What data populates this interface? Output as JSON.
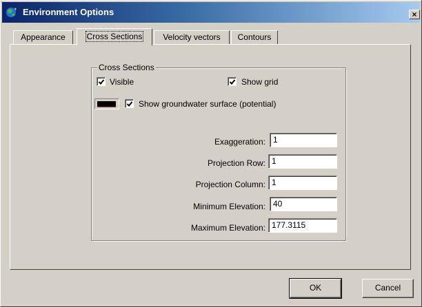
{
  "window": {
    "title": "Environment Options",
    "close_glyph": "×",
    "icon": "globe-icon"
  },
  "tabs": [
    {
      "label": "Appearance",
      "active": false
    },
    {
      "label": "Cross Sections",
      "active": true
    },
    {
      "label": "Velocity vectors",
      "active": false
    },
    {
      "label": "Contours",
      "active": false
    }
  ],
  "cross_sections": {
    "group_label": "Cross Sections",
    "visible": {
      "label": "Visible",
      "checked": true
    },
    "show_grid": {
      "label": "Show grid",
      "checked": true
    },
    "groundwater": {
      "label": "Show groundwater surface (potential)",
      "checked": true,
      "color": "#000000"
    },
    "fields": [
      {
        "label": "Exaggeration:",
        "value": "1"
      },
      {
        "label": "Projection Row:",
        "value": "1"
      },
      {
        "label": "Projection Column:",
        "value": "1"
      },
      {
        "label": "Minimum Elevation:",
        "value": "40"
      },
      {
        "label": "Maximum Elevation:",
        "value": "177.3115"
      }
    ]
  },
  "buttons": {
    "ok": "OK",
    "cancel": "Cancel"
  }
}
